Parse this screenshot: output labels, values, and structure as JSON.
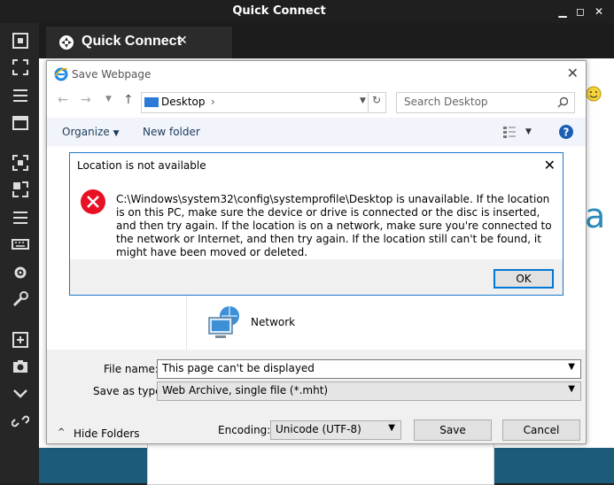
{
  "app": {
    "title": "Quick Connect",
    "tab_label": "Quick Connect",
    "tab_close": "✕"
  },
  "save_dialog": {
    "title": "Save Webpage",
    "location": "Desktop",
    "search_placeholder": "Search Desktop",
    "organize_label": "Organize",
    "new_folder_label": "New folder",
    "network_label": "Network",
    "file_name_label": "File name:",
    "file_name_value": "This page can't be displayed",
    "save_as_type_label": "Save as type:",
    "save_as_type_value": "Web Archive, single file (*.mht)",
    "hide_folders_label": "Hide Folders",
    "encoding_label": "Encoding:",
    "encoding_value": "Unicode (UTF-8)",
    "save_button": "Save",
    "cancel_button": "Cancel"
  },
  "error_dialog": {
    "title": "Location is not available",
    "message": "C:\\Windows\\system32\\config\\systemprofile\\Desktop is unavailable. If the location is on this PC, make sure the device or drive is connected or the disc is inserted, and then try again. If the location is on a network, make sure you're connected to the network or Internet, and then try again. If the location still can't be found, it might have been moved or deleted.",
    "ok_button": "OK"
  },
  "background": {
    "partial_letter": "a"
  },
  "colors": {
    "error_red": "#e81123",
    "accent_blue": "#0078d7",
    "help_blue": "#1a5fb4"
  }
}
